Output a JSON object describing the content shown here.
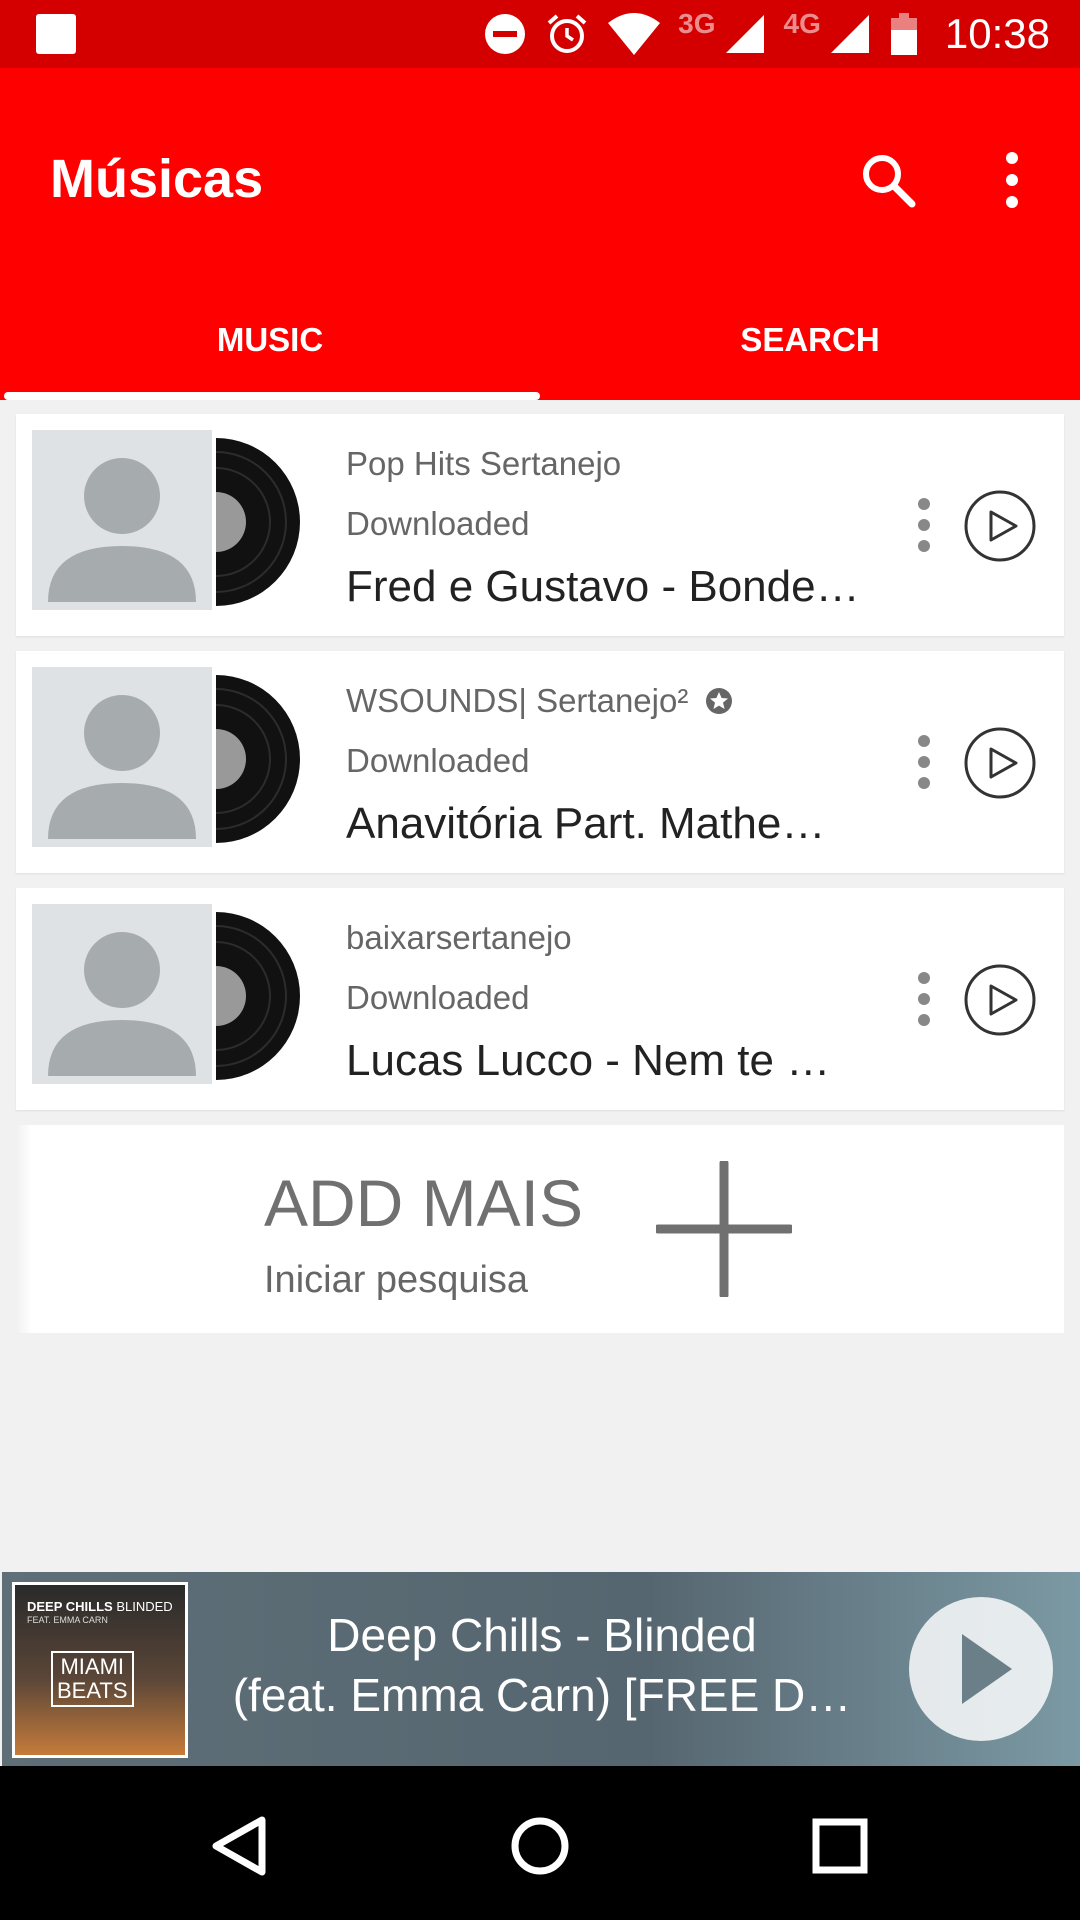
{
  "status_bar": {
    "time": "10:38",
    "network_3g": "3G",
    "network_4g": "4G",
    "icons": [
      "notification-square-icon",
      "do-not-disturb-icon",
      "alarm-icon",
      "wifi-icon",
      "signal-icon",
      "signal-icon",
      "battery-icon"
    ]
  },
  "app_bar": {
    "title": "Músicas",
    "search_icon": "search-icon",
    "menu_icon": "more-vert-icon"
  },
  "tabs": [
    {
      "label": "MUSIC",
      "selected": true
    },
    {
      "label": "SEARCH",
      "selected": false
    }
  ],
  "songs": [
    {
      "channel": "Pop Hits Sertanejo",
      "status": "Downloaded",
      "title": "Fred e Gustavo - Bonde…",
      "verified": false
    },
    {
      "channel": "WSOUNDS| Sertanejo²",
      "status": "Downloaded",
      "title": "Anavitória Part. Mathe…",
      "verified": true
    },
    {
      "channel": "baixarsertanejo",
      "status": "Downloaded",
      "title": "Lucas Lucco - Nem te …",
      "verified": false
    }
  ],
  "add_more": {
    "title": "ADD MAIS",
    "subtitle": "Iniciar pesquisa"
  },
  "player": {
    "cover": {
      "line1": "DEEP CHILLS",
      "line1b": "BLINDED",
      "line2": "FEAT. EMMA CARN",
      "badge1": "MIAMI",
      "badge2": "BEATS"
    },
    "title_line1": "Deep Chills - Blinded",
    "title_line2": "(feat. Emma Carn) [FREE D…"
  },
  "colors": {
    "status_bar": "#d40000",
    "app_bar": "#ff0000",
    "nav_bar": "#000000"
  }
}
